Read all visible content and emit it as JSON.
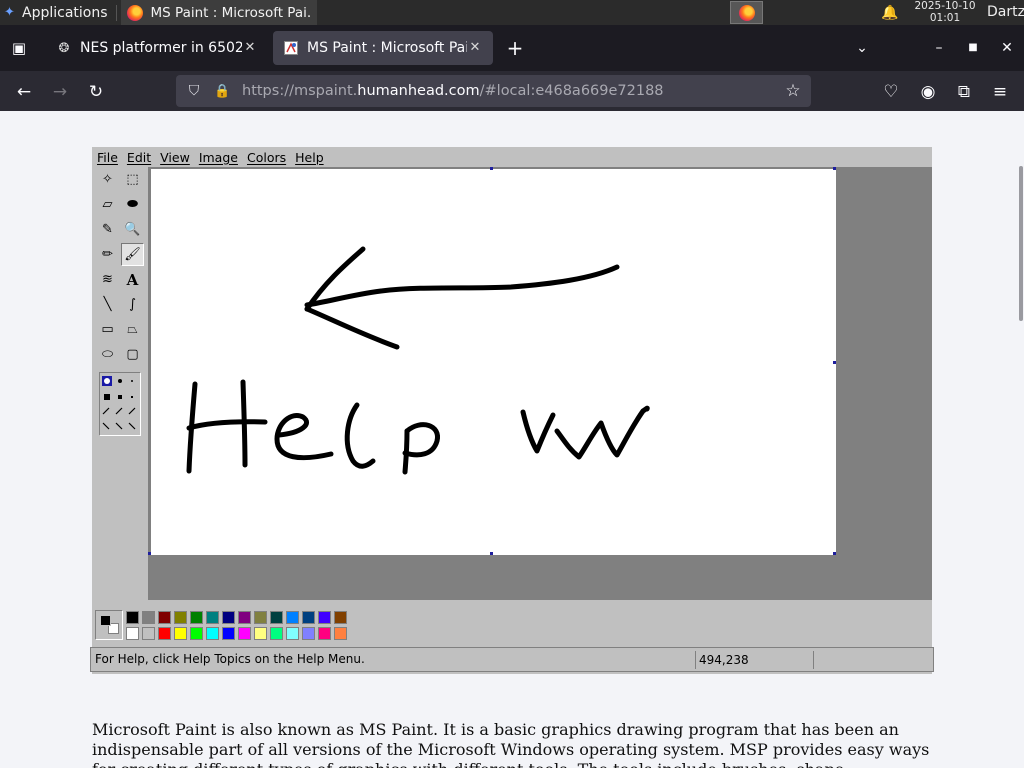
{
  "taskbar": {
    "apps_label": "Applications",
    "window_label": "MS Paint : Microsoft Pai...",
    "clock_date": "2025-10-10",
    "clock_time": "01:01",
    "user": "Dartz"
  },
  "tabs": [
    {
      "label": "NES platformer in 6502",
      "favicon": "chatgpt-icon"
    },
    {
      "label": "MS Paint : Microsoft Paint",
      "favicon": "paint-icon",
      "active": true
    }
  ],
  "urlbar": {
    "scheme": "https://mspaint.",
    "host": "humanhead.com",
    "path": "/#local:e468a669e72188"
  },
  "paint": {
    "menu": [
      "File",
      "Edit",
      "View",
      "Image",
      "Colors",
      "Help"
    ],
    "tools": [
      {
        "name": "free-select-icon",
        "glyph": "✧"
      },
      {
        "name": "rect-select-icon",
        "glyph": "⬚"
      },
      {
        "name": "eraser-icon",
        "glyph": "▱"
      },
      {
        "name": "fill-bucket-icon",
        "glyph": "⬬"
      },
      {
        "name": "color-picker-icon",
        "glyph": "✎"
      },
      {
        "name": "magnifier-icon",
        "glyph": "🔍"
      },
      {
        "name": "pencil-icon",
        "glyph": "✏"
      },
      {
        "name": "brush-icon",
        "glyph": "🖌"
      },
      {
        "name": "airbrush-icon",
        "glyph": "≋"
      },
      {
        "name": "text-tool-icon",
        "glyph": "A"
      },
      {
        "name": "line-icon",
        "glyph": "╲"
      },
      {
        "name": "curve-icon",
        "glyph": "∫"
      },
      {
        "name": "rectangle-icon",
        "glyph": "▭"
      },
      {
        "name": "polygon-icon",
        "glyph": "⏢"
      },
      {
        "name": "ellipse-icon",
        "glyph": "⬭"
      },
      {
        "name": "rounded-rect-icon",
        "glyph": "▢"
      }
    ],
    "selected_tool": "brush-icon",
    "palette_top": [
      "#000000",
      "#808080",
      "#800000",
      "#808000",
      "#008000",
      "#008080",
      "#000080",
      "#800080",
      "#808040",
      "#004040",
      "#0080ff",
      "#004080",
      "#4000ff",
      "#804000"
    ],
    "palette_bottom": [
      "#ffffff",
      "#c0c0c0",
      "#ff0000",
      "#ffff00",
      "#00ff00",
      "#00ffff",
      "#0000ff",
      "#ff00ff",
      "#ffff80",
      "#00ff80",
      "#80ffff",
      "#8080ff",
      "#ff0080",
      "#ff8040"
    ],
    "foreground_color": "#000000",
    "background_color": "#ffffff",
    "status_text": "For Help, click Help Topics on the Help Menu.",
    "status_coords": "494,238",
    "drawing_text": "Help vw"
  },
  "article": {
    "text": "Microsoft Paint is also known as MS Paint. It is a basic graphics drawing program that has been an indispensable part of all versions of the Microsoft Windows operating system. MSP provides easy ways for creating different types of graphics with different tools. The tools include brushes, shape"
  }
}
